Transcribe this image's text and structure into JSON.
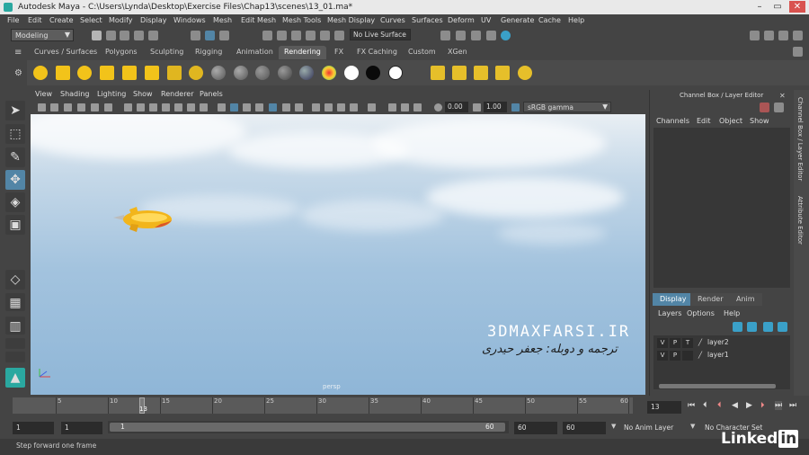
{
  "window": {
    "title": "Autodesk Maya - C:\\Users\\Lynda\\Desktop\\Exercise Files\\Chap13\\scenes\\13_01.ma*"
  },
  "menu": [
    "File",
    "Edit",
    "Create",
    "Select",
    "Modify",
    "Display",
    "Windows",
    "Mesh",
    "Edit Mesh",
    "Mesh Tools",
    "Mesh Display",
    "Curves",
    "Surfaces",
    "Deform",
    "UV",
    "Generate",
    "Cache",
    "Help"
  ],
  "status": {
    "mode": "Modeling",
    "live_surface": "No Live Surface"
  },
  "shelf_tabs": [
    "Curves / Surfaces",
    "Polygons",
    "Sculpting",
    "Rigging",
    "Animation",
    "Rendering",
    "FX",
    "FX Caching",
    "Custom",
    "XGen"
  ],
  "active_shelf_tab": "Rendering",
  "viewport": {
    "menu": [
      "View",
      "Shading",
      "Lighting",
      "Show",
      "Renderer",
      "Panels"
    ],
    "exposure": "0.00",
    "gamma": "1.00",
    "color_space": "sRGB gamma",
    "camera": "persp"
  },
  "watermark": {
    "line1": "3DMAXFARSI.IR",
    "line2": "ترجمه و دوبله: جعفر حیدری"
  },
  "timeline": {
    "ticks": [
      "5",
      "10",
      "15",
      "20",
      "25",
      "30",
      "35",
      "40",
      "45",
      "50",
      "55",
      "60"
    ],
    "current": "13",
    "current_field": "13"
  },
  "range": {
    "start": "1",
    "start2": "1",
    "inner_start": "1",
    "inner_end": "60",
    "end": "60",
    "end2": "60"
  },
  "anim_layer": "No Anim Layer",
  "char_set": "No Character Set",
  "channel_box": {
    "title": "Channel Box / Layer Editor",
    "menu": [
      "Channels",
      "Edit",
      "Object",
      "Show"
    ]
  },
  "layer_editor": {
    "tabs": [
      "Display",
      "Render",
      "Anim"
    ],
    "menu": [
      "Layers",
      "Options",
      "Help"
    ],
    "layers": [
      {
        "v": "V",
        "p": "P",
        "t": "T",
        "name": "layer2"
      },
      {
        "v": "V",
        "p": "P",
        "t": "",
        "name": "layer1"
      }
    ]
  },
  "side_tabs": [
    "Channel Box / Layer Editor",
    "Attribute Editor"
  ],
  "help_line": "Step forward one frame",
  "brand": {
    "name": "Linked",
    "suffix": "in"
  }
}
